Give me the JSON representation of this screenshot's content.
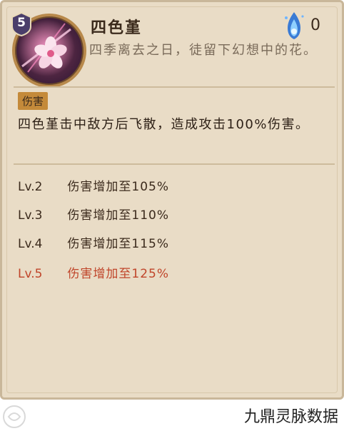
{
  "skill": {
    "level_badge": "5",
    "name": "四色堇",
    "cost": "0",
    "description": "四季离去之日，徒留下幻想中的花。",
    "tag": "伤害",
    "effect": "四色堇击中敌方后飞散，造成攻击100%伤害。",
    "icon": "pink-flower-icon",
    "cost_icon": "blue-spirit-fire-icon"
  },
  "level_ups": [
    {
      "lv": "Lv.2",
      "text": "伤害增加至105%",
      "current": false
    },
    {
      "lv": "Lv.3",
      "text": "伤害增加至110%",
      "current": false
    },
    {
      "lv": "Lv.4",
      "text": "伤害增加至115%",
      "current": false
    },
    {
      "lv": "Lv.5",
      "text": "伤害增加至125%",
      "current": true
    }
  ],
  "watermark": "九鼎灵脉数据",
  "footer_logo": "seal-logo-icon",
  "colors": {
    "panel_bg": "#e9dcc6",
    "tag_bg": "#c48a3a",
    "max_level_text": "#c0452a",
    "badge": "#4a3e6a"
  }
}
